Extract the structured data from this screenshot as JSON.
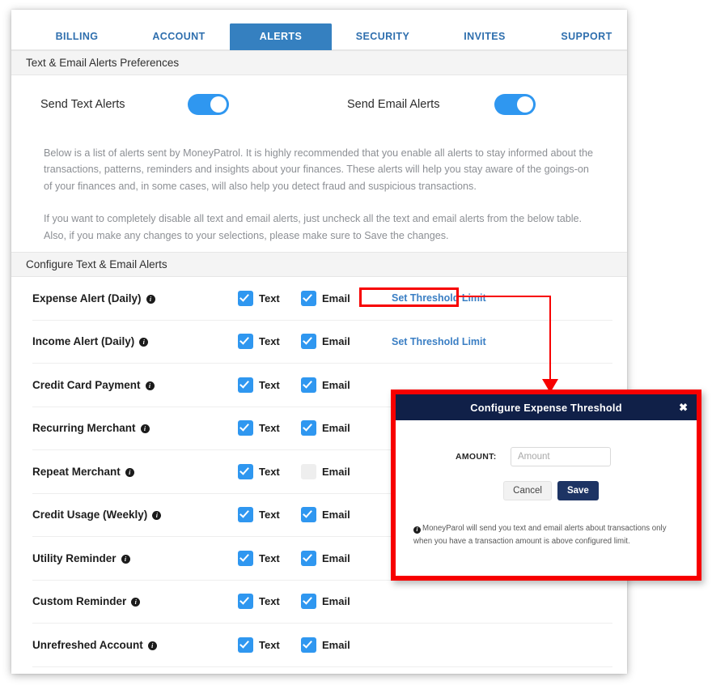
{
  "tabs": [
    {
      "label": "BILLING",
      "active": false
    },
    {
      "label": "ACCOUNT",
      "active": false
    },
    {
      "label": "ALERTS",
      "active": true
    },
    {
      "label": "SECURITY",
      "active": false
    },
    {
      "label": "INVITES",
      "active": false
    },
    {
      "label": "SUPPORT",
      "active": false
    }
  ],
  "preferences": {
    "section_title": "Text & Email Alerts Preferences",
    "text_alerts_label": "Send Text Alerts",
    "text_alerts_on": true,
    "email_alerts_label": "Send Email Alerts",
    "email_alerts_on": true,
    "paragraph_1": "Below is a list of alerts sent by MoneyPatrol. It is highly recommended that you enable all alerts to stay informed about the transactions, patterns, reminders and insights about your finances. These alerts will help you stay aware of the goings-on of your finances and, in some cases, will also help you detect fraud and suspicious transactions.",
    "paragraph_2": "If you want to completely disable all text and email alerts, just uncheck all the text and email alerts from the below table. Also, if you make any changes to your selections, please make sure to Save the changes."
  },
  "configure": {
    "section_title": "Configure Text & Email Alerts",
    "text_label": "Text",
    "email_label": "Email",
    "threshold_link_label": "Set Threshold Limit",
    "rows": [
      {
        "name": "Expense Alert (Daily)",
        "text": true,
        "email": true,
        "threshold": "Set Threshold Limit",
        "highlighted": true
      },
      {
        "name": "Income Alert (Daily)",
        "text": true,
        "email": true,
        "threshold": "Set Threshold Limit",
        "highlighted": false
      },
      {
        "name": "Credit Card Payment",
        "text": true,
        "email": true,
        "threshold": "",
        "highlighted": false
      },
      {
        "name": "Recurring Merchant",
        "text": true,
        "email": true,
        "threshold": "",
        "highlighted": false
      },
      {
        "name": "Repeat Merchant",
        "text": true,
        "email": false,
        "threshold": "",
        "highlighted": false
      },
      {
        "name": "Credit Usage (Weekly)",
        "text": true,
        "email": true,
        "threshold": "",
        "highlighted": false
      },
      {
        "name": "Utility Reminder",
        "text": true,
        "email": true,
        "threshold": "",
        "highlighted": false
      },
      {
        "name": "Custom Reminder",
        "text": true,
        "email": true,
        "threshold": "",
        "highlighted": false
      },
      {
        "name": "Unrefreshed Account",
        "text": true,
        "email": true,
        "threshold": "",
        "highlighted": false
      }
    ]
  },
  "modal": {
    "title": "Configure Expense Threshold",
    "close_label": "✖",
    "amount_label": "AMOUNT:",
    "amount_value": "",
    "amount_placeholder": "Amount",
    "cancel_label": "Cancel",
    "save_label": "Save",
    "note": "MoneyParol will send you text and email alerts about transactions only when you have a transaction amount is above configured limit."
  },
  "colors": {
    "accent_blue": "#2f97f0",
    "tab_active_blue": "#3580c0",
    "link_blue": "#3b7fc4",
    "modal_navy": "#102048",
    "save_navy": "#1d3464",
    "highlight_red": "#f70000",
    "section_bar_gray": "#f4f4f4",
    "body_text_gray": "#8c8f94"
  },
  "icons": {
    "info": "info-icon",
    "check": "check-icon",
    "close": "close-icon"
  }
}
